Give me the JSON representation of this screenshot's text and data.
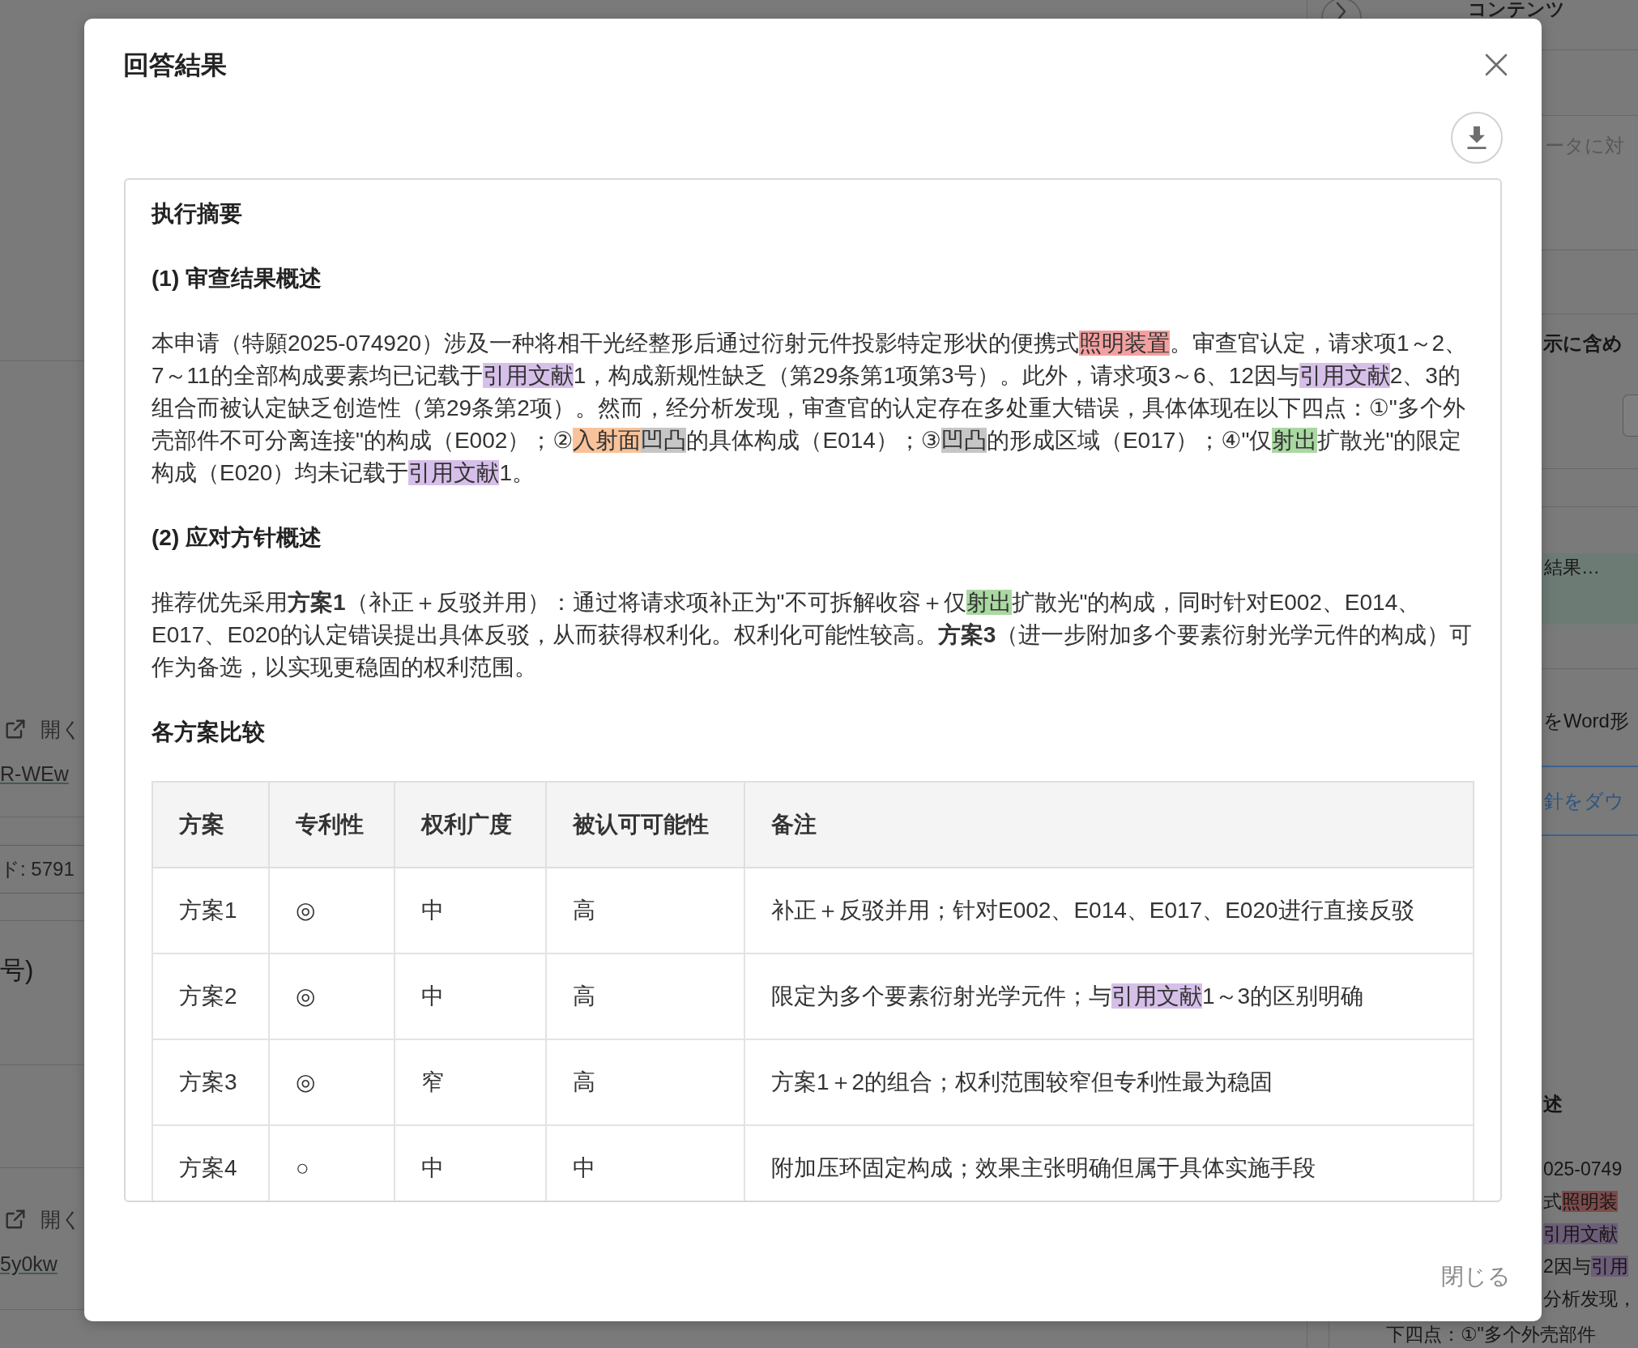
{
  "backdrop": {
    "left_strip": [
      {
        "kind": "link_card",
        "action": "開く",
        "url": "R-WEw"
      },
      {
        "kind": "code_box",
        "text": "ド: 5791"
      },
      {
        "kind": "heading",
        "text": "号)"
      },
      {
        "kind": "link_card",
        "action": "開く",
        "url": "5y0kw"
      }
    ],
    "top_strip": {
      "panel_title": "コンテンツ"
    },
    "right_strip": {
      "prompt_placeholder": "ータに対",
      "option_label": "示に含め",
      "status_text": "結果…",
      "description": "をWord形",
      "button_label": "針をダウ",
      "summary_heading": "述",
      "summary_lines": [
        {
          "runs": [
            {
              "text": "025-0749"
            }
          ]
        },
        {
          "runs": [
            {
              "text": "式"
            },
            {
              "text": "照明装",
              "color": "#7d4b4b"
            }
          ]
        },
        {
          "runs": [
            {
              "text": "引用文献",
              "color": "#6c5d78"
            }
          ]
        },
        {
          "runs": [
            {
              "text": "2因与"
            },
            {
              "text": "引用",
              "color": "#6c5d78"
            }
          ]
        },
        {
          "runs": [
            {
              "text": "分析发现，"
            }
          ]
        }
      ]
    },
    "bottom_strip": {
      "summary_line": "下四点：①\"多个外壳部件"
    }
  },
  "dialog": {
    "title": "回答結果",
    "content": [
      {
        "kind": "heading",
        "text": "执行摘要"
      },
      {
        "kind": "heading",
        "text": "(1) 审查结果概述"
      },
      {
        "kind": "paragraph",
        "runs": [
          {
            "text": "本申请（特願2025-074920）涉及一种将相干光经整形后通过衍射元件投影特定形状的便携式"
          },
          {
            "text": "照明装置",
            "color": "#f3a0a0"
          },
          {
            "text": "。审查官认定，请求项1～2、7～11的全部构成要素均已记载于"
          },
          {
            "text": "引用文献",
            "color": "#d6bfe9"
          },
          {
            "text": "1，构成新规性缺乏（第29条第1项第3号）。此外，请求项3～6、12因与"
          },
          {
            "text": "引用文献",
            "color": "#d6bfe9"
          },
          {
            "text": "2、3的组合而被认定缺乏创造性（第29条第2项）。然而，经分析发现，审查官的认定存在多处重大错误，具体体现在以下四点：①\"多个外壳部件不可分离连接\"的构成（E002）；②"
          },
          {
            "text": "入射面",
            "color": "#f8c39a"
          },
          {
            "text": "凹凸",
            "color": "#c6c6c6"
          },
          {
            "text": "的具体构成（E014）；③"
          },
          {
            "text": "凹凸",
            "color": "#c6c6c6"
          },
          {
            "text": "的形成区域（E017）；④\"仅"
          },
          {
            "text": "射出",
            "color": "#aad8a2"
          },
          {
            "text": "扩散光\"的限定构成（E020）均未记载于"
          },
          {
            "text": "引用文献",
            "color": "#d6bfe9"
          },
          {
            "text": "1。"
          }
        ]
      },
      {
        "kind": "heading",
        "text": "(2) 应对方针概述"
      },
      {
        "kind": "paragraph",
        "runs": [
          {
            "text": "推荐优先采用**方案1**（补正＋反驳并用）：通过将请求项补正为\"不可拆解收容＋仅"
          },
          {
            "text": "射出",
            "color": "#aad8a2"
          },
          {
            "text": "扩散光\"的构成，同时针对E002、E014、E017、E020的认定错误提出具体反驳，从而获得权利化。权利化可能性较高。**方案3**（进一步附加多个要素衍射光学元件的构成）可作为备选，以实现更稳固的权利范围。"
          }
        ]
      },
      {
        "kind": "heading",
        "text": "各方案比较"
      },
      {
        "kind": "table",
        "columns": [
          "方案",
          "专利性",
          "权利广度",
          "被认可可能性",
          "备注"
        ],
        "rows": [
          {
            "cells": [
              "方案1",
              "◎",
              "中",
              "高"
            ],
            "remarks": [
              {
                "text": "补正＋反驳并用；针对E002、E014、E017、E020进行直接反驳"
              }
            ]
          },
          {
            "cells": [
              "方案2",
              "◎",
              "中",
              "高"
            ],
            "remarks": [
              {
                "text": "限定为多个要素衍射光学元件；与"
              },
              {
                "text": "引用文献",
                "color": "#d6bfe9"
              },
              {
                "text": "1～3的区别明确"
              }
            ]
          },
          {
            "cells": [
              "方案3",
              "◎",
              "窄",
              "高"
            ],
            "remarks": [
              {
                "text": "方案1＋2的组合；权利范围较窄但专利性最为稳固"
              }
            ]
          },
          {
            "cells": [
              "方案4",
              "○",
              "中",
              "中"
            ],
            "remarks": [
              {
                "text": "附加压环固定构成；效果主张明确但属于具体实施手段"
              }
            ]
          }
        ]
      }
    ],
    "close_button": "閉じる"
  }
}
